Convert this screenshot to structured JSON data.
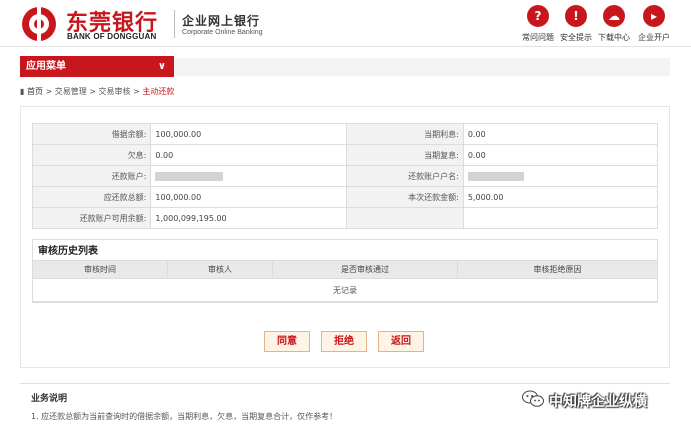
{
  "brand": {
    "name_cn": "东莞银行",
    "name_en": "BANK OF DONGGUAN",
    "system_cn": "企业网上银行",
    "system_en": "Corporate Online Banking",
    "primary_color": "#c8161d"
  },
  "toolbar": [
    {
      "icon": "question-icon",
      "glyph": "?",
      "label": "常问问题"
    },
    {
      "icon": "shield-icon",
      "glyph": "!",
      "label": "安全提示"
    },
    {
      "icon": "cloud-download-icon",
      "glyph": "☁",
      "label": "下载中心"
    },
    {
      "icon": "open-account-icon",
      "glyph": "▸",
      "label": "企业开户"
    }
  ],
  "menu": {
    "label": "应用菜单",
    "icon": "chevron-down-icon"
  },
  "breadcrumb": {
    "home": "首页",
    "items": [
      "交易管理",
      "交易审核",
      "主动还款"
    ],
    "sep": " > "
  },
  "details": {
    "loan_balance_label": "借据余额:",
    "loan_balance_value": "100,000.00",
    "interest_due_label": "当期利息:",
    "interest_due_value": "0.00",
    "owed_interest_label": "欠息:",
    "owed_interest_value": "0.00",
    "compound_interest_label": "当期复息:",
    "compound_interest_value": "0.00",
    "repay_account_label": "还款账户:",
    "repay_account_name_label": "还款账户户名:",
    "repay_total_label": "应还款总额:",
    "repay_total_value": "100,000.00",
    "this_repay_label": "本次还款金额:",
    "this_repay_value": "5,000.00",
    "available_balance_label": "还款账户可用余额:",
    "available_balance_value": "1,000,099,195.00"
  },
  "history": {
    "title": "审核历史列表",
    "columns": [
      "审核时间",
      "审核人",
      "是否审核通过",
      "审核拒绝原因"
    ],
    "empty_text": "无记录"
  },
  "actions": {
    "approve": "同意",
    "reject": "拒绝",
    "back": "返回"
  },
  "notes": {
    "title": "业务说明",
    "line1": "1. 应还款总额为当前查询时的借据余额，当期利息，欠息，当期复息合计，仅作参考！"
  },
  "watermark": {
    "text": "中知牌企业纵横"
  }
}
